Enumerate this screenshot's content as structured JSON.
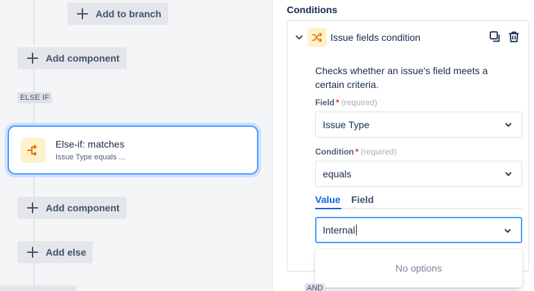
{
  "canvas": {
    "add_to_branch": "Add to branch",
    "add_component_1": "Add component",
    "else_if_lozenge": "ELSE IF",
    "card": {
      "title": "Else-if: matches",
      "subtitle": "Issue Type equals ..."
    },
    "add_component_2": "Add component",
    "add_else": "Add else"
  },
  "panel": {
    "section_title": "Conditions",
    "condition": {
      "title": "Issue fields condition",
      "icon": "shuffle-icon",
      "description": "Checks whether an issue's field meets a certain criteria."
    },
    "field": {
      "label": "Field",
      "required_marker": "*",
      "required_text": "(required)",
      "value": "Issue Type"
    },
    "condition_select": {
      "label": "Condition",
      "required_marker": "*",
      "required_text": "(required)",
      "value": "equals"
    },
    "tabs": [
      "Value",
      "Field"
    ],
    "value_input": "Internal",
    "dropdown_message": "No options",
    "and_tag": "AND"
  },
  "colors": {
    "accent": "#0c66e4",
    "focus": "#4c9aff",
    "icon_bg": "#fff1cc",
    "icon_fg": "#e2740f",
    "required": "#de350b"
  }
}
